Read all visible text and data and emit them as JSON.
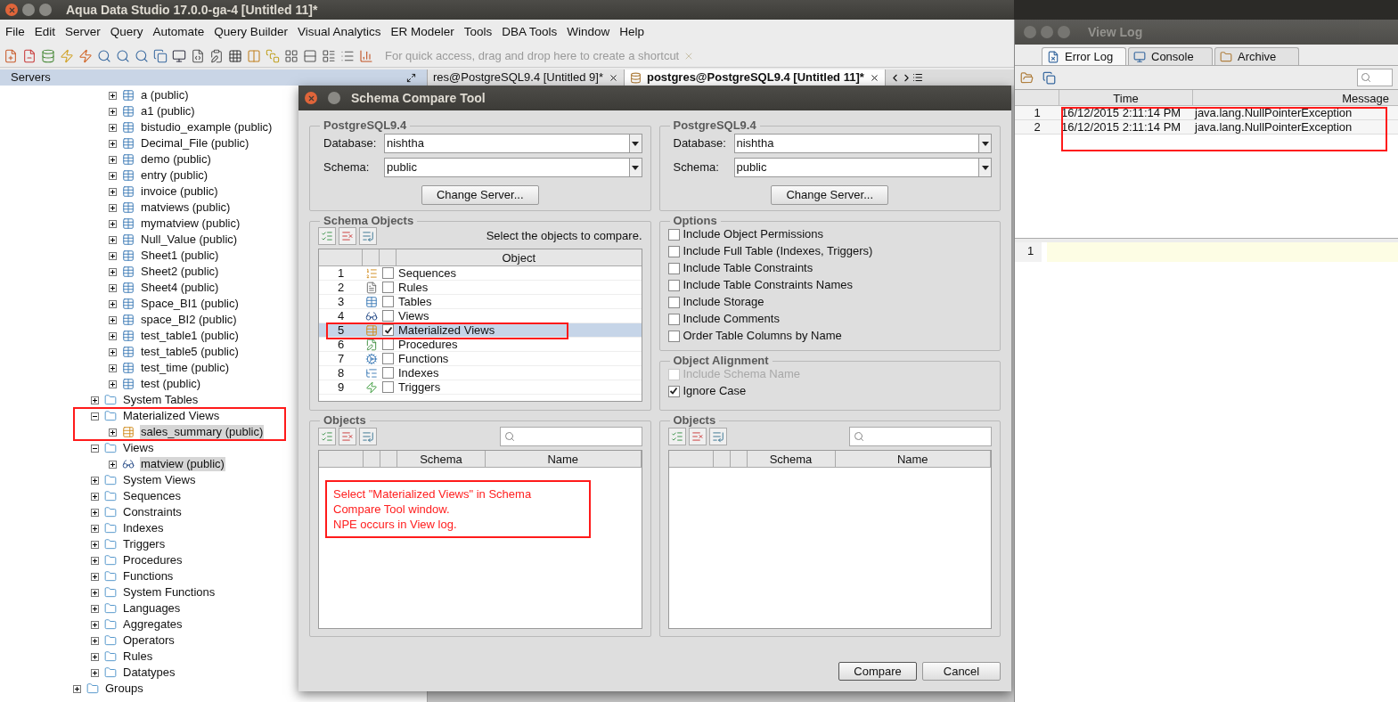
{
  "main_window": {
    "title": "Aqua Data Studio 17.0.0-ga-4 [Untitled 11]*",
    "menu": [
      "File",
      "Edit",
      "Server",
      "Query",
      "Automate",
      "Query Builder",
      "Visual Analytics",
      "ER Modeler",
      "Tools",
      "DBA Tools",
      "Window",
      "Help"
    ],
    "shortcut_hint": "For quick access, drag and drop here to create a shortcut",
    "servers_panel": {
      "title": "Servers",
      "tree": [
        {
          "children": [
            {
              "children": [
                {
                  "label": "a (public)",
                  "kind": "table",
                  "expanded": false,
                  "selected": false
                },
                {
                  "label": "a1 (public)",
                  "kind": "table",
                  "expanded": false,
                  "selected": false
                },
                {
                  "label": "bistudio_example (public)",
                  "kind": "table",
                  "expanded": false,
                  "selected": false
                },
                {
                  "label": "Decimal_File (public)",
                  "kind": "table",
                  "expanded": false,
                  "selected": false
                },
                {
                  "label": "demo (public)",
                  "kind": "table",
                  "expanded": false,
                  "selected": false
                },
                {
                  "label": "entry (public)",
                  "kind": "table",
                  "expanded": false,
                  "selected": false
                },
                {
                  "label": "invoice (public)",
                  "kind": "table",
                  "expanded": false,
                  "selected": false
                },
                {
                  "label": "matviews (public)",
                  "kind": "table",
                  "expanded": false,
                  "selected": false
                },
                {
                  "label": "mymatview (public)",
                  "kind": "table",
                  "expanded": false,
                  "selected": false
                },
                {
                  "label": "Null_Value (public)",
                  "kind": "table",
                  "expanded": false,
                  "selected": false
                },
                {
                  "label": "Sheet1 (public)",
                  "kind": "table",
                  "expanded": false,
                  "selected": false
                },
                {
                  "label": "Sheet2 (public)",
                  "kind": "table",
                  "expanded": false,
                  "selected": false
                },
                {
                  "label": "Sheet4 (public)",
                  "kind": "table",
                  "expanded": false,
                  "selected": false
                },
                {
                  "label": "Space_BI1 (public)",
                  "kind": "table",
                  "expanded": false,
                  "selected": false
                },
                {
                  "label": "space_BI2 (public)",
                  "kind": "table",
                  "expanded": false,
                  "selected": false
                },
                {
                  "label": "test_table1 (public)",
                  "kind": "table",
                  "expanded": false,
                  "selected": false
                },
                {
                  "label": "test_table5 (public)",
                  "kind": "table",
                  "expanded": false,
                  "selected": false
                },
                {
                  "label": "test_time (public)",
                  "kind": "table",
                  "expanded": false,
                  "selected": false
                },
                {
                  "label": "test (public)",
                  "kind": "table",
                  "expanded": false,
                  "selected": false
                }
              ]
            },
            {
              "label": "System Tables",
              "kind": "folder",
              "expanded": false,
              "selected": false
            },
            {
              "label": "Materialized Views",
              "kind": "folder",
              "expanded": true,
              "selected": false,
              "children": [
                {
                  "label": "sales_summary (public)",
                  "kind": "matview",
                  "expanded": false,
                  "selected": true
                }
              ]
            },
            {
              "label": "Views",
              "kind": "folder",
              "expanded": true,
              "selected": false,
              "children": [
                {
                  "label": "matview (public)",
                  "kind": "view",
                  "expanded": false,
                  "selected": true
                }
              ]
            },
            {
              "label": "System Views",
              "kind": "folder",
              "expanded": false,
              "selected": false
            },
            {
              "label": "Sequences",
              "kind": "folder",
              "expanded": false,
              "selected": false
            },
            {
              "label": "Constraints",
              "kind": "folder",
              "expanded": false,
              "selected": false
            },
            {
              "label": "Indexes",
              "kind": "folder",
              "expanded": false,
              "selected": false
            },
            {
              "label": "Triggers",
              "kind": "folder",
              "expanded": false,
              "selected": false
            },
            {
              "label": "Procedures",
              "kind": "folder",
              "expanded": false,
              "selected": false
            },
            {
              "label": "Functions",
              "kind": "folder",
              "expanded": false,
              "selected": false
            },
            {
              "label": "System Functions",
              "kind": "folder",
              "expanded": false,
              "selected": false
            },
            {
              "label": "Languages",
              "kind": "folder",
              "expanded": false,
              "selected": false
            },
            {
              "label": "Aggregates",
              "kind": "folder",
              "expanded": false,
              "selected": false
            },
            {
              "label": "Operators",
              "kind": "folder",
              "expanded": false,
              "selected": false
            },
            {
              "label": "Rules",
              "kind": "folder",
              "expanded": false,
              "selected": false
            },
            {
              "label": "Datatypes",
              "kind": "folder",
              "expanded": false,
              "selected": false
            }
          ]
        },
        {
          "label": "Groups",
          "kind": "folder",
          "expanded": false,
          "selected": false
        }
      ]
    },
    "editor_tabs": [
      {
        "label": "res@PostgreSQL9.4 [Untitled 9]*",
        "selected": false
      },
      {
        "label": "postgres@PostgreSQL9.4 [Untitled 11]*",
        "selected": true
      }
    ]
  },
  "dialog": {
    "title": "Schema Compare Tool",
    "sources": [
      {
        "server": "PostgreSQL9.4",
        "database_label": "Database:",
        "database": "nishtha",
        "schema_label": "Schema:",
        "schema": "public",
        "button": "Change Server..."
      },
      {
        "server": "PostgreSQL9.4",
        "database_label": "Database:",
        "database": "nishtha",
        "schema_label": "Schema:",
        "schema": "public",
        "button": "Change Server..."
      }
    ],
    "schema_objects": {
      "title": "Schema Objects",
      "hint": "Select the objects to compare.",
      "column": "Object",
      "rows": [
        {
          "number": "1",
          "kind": "sequence",
          "label": "Sequences",
          "checked": false,
          "selected": false
        },
        {
          "number": "2",
          "kind": "rule",
          "label": "Rules",
          "checked": false,
          "selected": false
        },
        {
          "number": "3",
          "kind": "table",
          "label": "Tables",
          "checked": false,
          "selected": false
        },
        {
          "number": "4",
          "kind": "view",
          "label": "Views",
          "checked": false,
          "selected": false
        },
        {
          "number": "5",
          "kind": "matview",
          "label": "Materialized Views",
          "checked": true,
          "selected": true
        },
        {
          "number": "6",
          "kind": "procedure",
          "label": "Procedures",
          "checked": false,
          "selected": false
        },
        {
          "number": "7",
          "kind": "function",
          "label": "Functions",
          "checked": false,
          "selected": false
        },
        {
          "number": "8",
          "kind": "index",
          "label": "Indexes",
          "checked": false,
          "selected": false
        },
        {
          "number": "9",
          "kind": "trigger",
          "label": "Triggers",
          "checked": false,
          "selected": false
        }
      ]
    },
    "options": {
      "title": "Options",
      "items": [
        {
          "label": "Include Object Permissions",
          "checked": false,
          "disabled": false
        },
        {
          "label": "Include Full Table (Indexes, Triggers)",
          "checked": false,
          "disabled": false
        },
        {
          "label": "Include Table Constraints",
          "checked": false,
          "disabled": false
        },
        {
          "label": "Include Table Constraints Names",
          "checked": false,
          "disabled": false
        },
        {
          "label": "Include Storage",
          "checked": false,
          "disabled": false
        },
        {
          "label": "Include Comments",
          "checked": false,
          "disabled": false
        },
        {
          "label": "Order Table Columns by Name",
          "checked": false,
          "disabled": false
        }
      ]
    },
    "alignment": {
      "title": "Object Alignment",
      "items": [
        {
          "label": "Include Schema Name",
          "checked": false,
          "disabled": true
        },
        {
          "label": "Ignore Case",
          "checked": true,
          "disabled": false
        }
      ]
    },
    "object_panels": [
      {
        "title": "Objects",
        "columns": [
          "Schema",
          "Name"
        ],
        "note_lines": [
          "Select \"Materialized Views\" in Schema",
          "Compare Tool window.",
          "NPE occurs in View log."
        ]
      },
      {
        "title": "Objects",
        "columns": [
          "Schema",
          "Name"
        ]
      }
    ],
    "buttons": [
      "Compare",
      "Cancel"
    ]
  },
  "view_log": {
    "title": "View Log",
    "tabs": [
      {
        "label": "Error Log",
        "kind": "error",
        "selected": true
      },
      {
        "label": "Console",
        "kind": "console",
        "selected": false
      },
      {
        "label": "Archive",
        "kind": "archive",
        "selected": false
      }
    ],
    "columns": [
      "Time",
      "Message"
    ],
    "rows": [
      {
        "number": "1",
        "time": "16/12/2015 2:11:14 PM",
        "message": "java.lang.NullPointerException"
      },
      {
        "number": "2",
        "time": "16/12/2015 2:11:14 PM",
        "message": "java.lang.NullPointerException"
      }
    ],
    "editor_line": "1"
  }
}
